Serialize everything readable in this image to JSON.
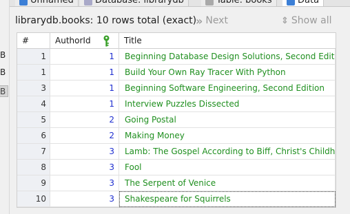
{
  "left_strip": {
    "chips": [
      "B",
      "B",
      "B"
    ]
  },
  "tabs": [
    {
      "label": "Unnamed",
      "icon": "database-icon",
      "color": "#3c7fd6"
    },
    {
      "label": "Database: librarydb",
      "icon": "database-icon",
      "color": "#a9a9c8"
    },
    {
      "label": "Table: books",
      "icon": "table-icon",
      "color": "#a9a9a9"
    },
    {
      "label": "Data",
      "icon": "grid-icon",
      "color": "#3c7fd6"
    }
  ],
  "toolbar": {
    "status": "librarydb.books: 10 rows total (exact)",
    "next_label": "Next",
    "show_all_label": "Show all"
  },
  "grid": {
    "columns": [
      "#",
      "AuthorId",
      "Title"
    ],
    "rows": [
      {
        "num": "1",
        "author_id": "1",
        "title": "Beginning Database Design Solutions, Second Edition"
      },
      {
        "num": "1",
        "author_id": "1",
        "title": "Build Your Own Ray Tracer With Python"
      },
      {
        "num": "3",
        "author_id": "1",
        "title": "Beginning Software Engineering, Second Edition"
      },
      {
        "num": "4",
        "author_id": "1",
        "title": "Interview Puzzles Dissected"
      },
      {
        "num": "5",
        "author_id": "2",
        "title": "Going Postal"
      },
      {
        "num": "6",
        "author_id": "2",
        "title": "Making Money"
      },
      {
        "num": "7",
        "author_id": "3",
        "title": "Lamb: The Gospel According to Biff, Christ's Childh..."
      },
      {
        "num": "8",
        "author_id": "3",
        "title": "Fool"
      },
      {
        "num": "9",
        "author_id": "3",
        "title": "The Serpent of Venice"
      },
      {
        "num": "10",
        "author_id": "3",
        "title": "Shakespeare for Squirrels"
      }
    ],
    "colors": {
      "id_text": "#1f2fd0",
      "title_text": "#1f8f1f",
      "key_icon": "#3aa02a"
    }
  }
}
